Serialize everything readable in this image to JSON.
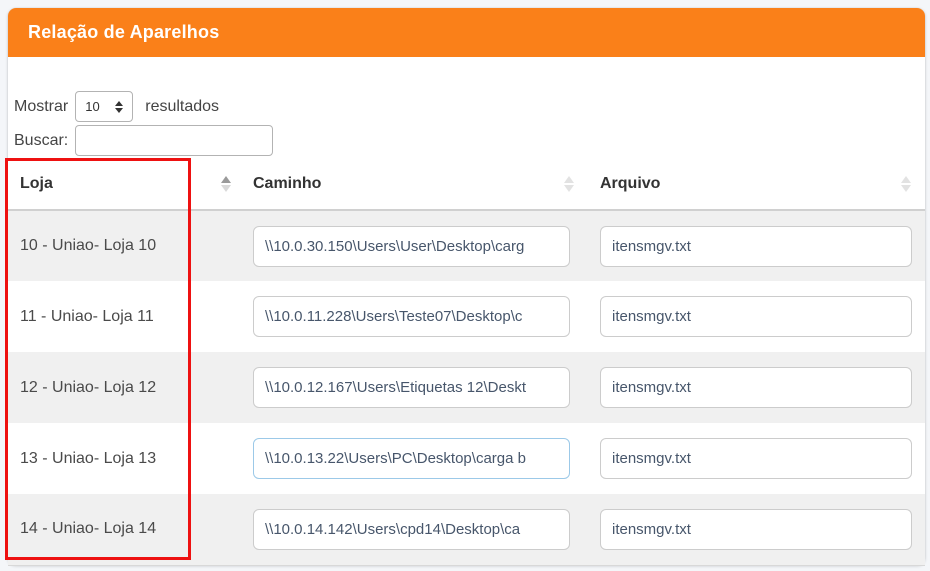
{
  "panel": {
    "title": "Relação de Aparelhos",
    "header_color": "#fa8019"
  },
  "controls": {
    "show_label": "Mostrar",
    "page_length_value": "10",
    "results_label": "resultados",
    "search_label": "Buscar:",
    "search_value": ""
  },
  "table": {
    "columns": [
      {
        "label": "Loja",
        "sort": "asc"
      },
      {
        "label": "Caminho",
        "sort": "none"
      },
      {
        "label": "Arquivo",
        "sort": "none"
      }
    ],
    "rows": [
      {
        "loja": "10 - Uniao- Loja 10",
        "caminho": "\\\\10.0.30.150\\Users\\User\\Desktop\\carg",
        "arquivo": "itensmgv.txt",
        "caminho_focused": false
      },
      {
        "loja": "11 - Uniao- Loja 11",
        "caminho": "\\\\10.0.11.228\\Users\\Teste07\\Desktop\\c",
        "arquivo": "itensmgv.txt",
        "caminho_focused": false
      },
      {
        "loja": "12 - Uniao- Loja 12",
        "caminho": "\\\\10.0.12.167\\Users\\Etiquetas 12\\Deskt",
        "arquivo": "itensmgv.txt",
        "caminho_focused": false
      },
      {
        "loja": "13 - Uniao- Loja 13",
        "caminho": "\\\\10.0.13.22\\Users\\PC\\Desktop\\carga b",
        "arquivo": "itensmgv.txt",
        "caminho_focused": true
      },
      {
        "loja": "14 - Uniao- Loja 14",
        "caminho": "\\\\10.0.14.142\\Users\\cpd14\\Desktop\\ca",
        "arquivo": "itensmgv.txt",
        "caminho_focused": false
      }
    ]
  },
  "annotation": {
    "color": "#ee1111",
    "focus_border_color": "#9cc9e8"
  }
}
